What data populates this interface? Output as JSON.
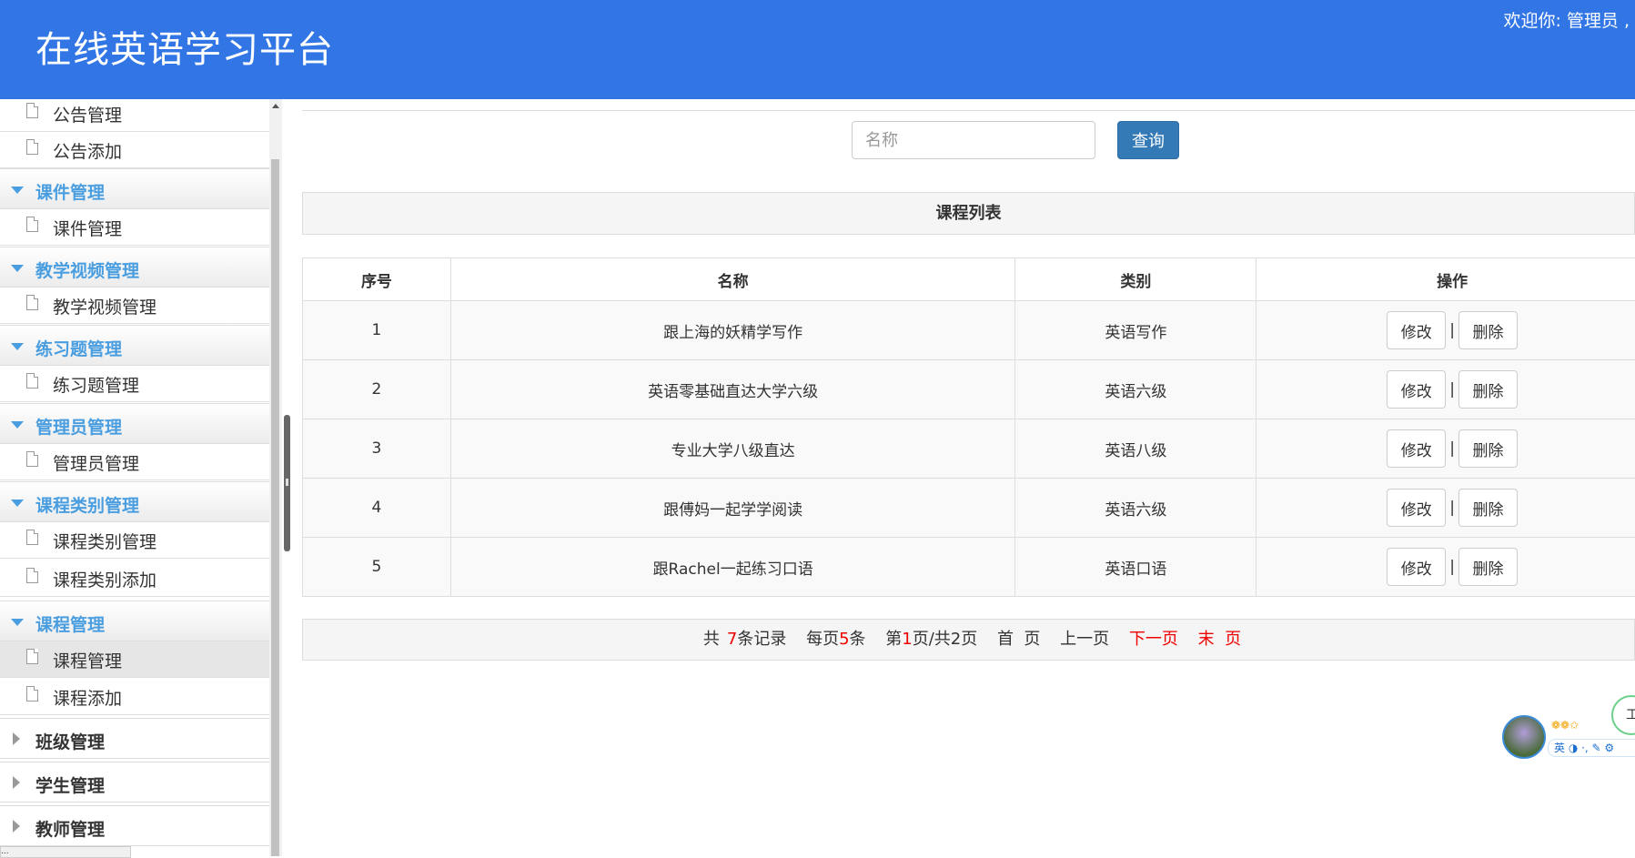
{
  "header": {
    "title": "在线英语学习平台",
    "welcome": "欢迎你: 管理员 ,"
  },
  "sidebar": {
    "top_items": [
      {
        "label": "公告管理"
      },
      {
        "label": "公告添加"
      }
    ],
    "groups": [
      {
        "label": "课件管理",
        "items": [
          {
            "label": "课件管理"
          }
        ]
      },
      {
        "label": "教学视频管理",
        "items": [
          {
            "label": "教学视频管理"
          }
        ]
      },
      {
        "label": "练习题管理",
        "items": [
          {
            "label": "练习题管理"
          }
        ]
      },
      {
        "label": "管理员管理",
        "items": [
          {
            "label": "管理员管理"
          }
        ]
      },
      {
        "label": "课程类别管理",
        "items": [
          {
            "label": "课程类别管理"
          },
          {
            "label": "课程类别添加"
          }
        ]
      },
      {
        "label": "课程管理",
        "items": [
          {
            "label": "课程管理"
          },
          {
            "label": "课程添加"
          }
        ]
      }
    ],
    "collapsed_groups": [
      {
        "label": "班级管理"
      },
      {
        "label": "学生管理"
      },
      {
        "label": "教师管理"
      }
    ],
    "active_item": "课程管理"
  },
  "status_bar": "...",
  "search": {
    "placeholder": "名称",
    "value": "",
    "button_label": "查询"
  },
  "list": {
    "title": "课程列表",
    "columns": [
      "序号",
      "名称",
      "类别",
      "操作"
    ],
    "rows": [
      {
        "index": "1",
        "name": "跟上海的妖精学写作",
        "category": "英语写作"
      },
      {
        "index": "2",
        "name": "英语零基础直达大学六级",
        "category": "英语六级"
      },
      {
        "index": "3",
        "name": "专业大学八级直达",
        "category": "英语八级"
      },
      {
        "index": "4",
        "name": "跟傅妈一起学学阅读",
        "category": "英语六级"
      },
      {
        "index": "5",
        "name": "跟Rachel一起练习口语",
        "category": "英语口语"
      }
    ],
    "edit_label": "修改",
    "delete_label": "删除",
    "separator": "|"
  },
  "pager": {
    "total_prefix": "共",
    "total": "7",
    "total_suffix": "条记录",
    "per_page_prefix": "每页",
    "per_page": "5",
    "per_page_suffix": "条",
    "page_prefix": "第",
    "current": "1",
    "page_mid": "页/共",
    "pages": "2",
    "page_suffix": "页",
    "first": "首  页",
    "prev": "上一页",
    "next": "下一页",
    "last": "末  页"
  },
  "widget": {
    "stars": "❁❁✩",
    "toolbar": "英 ◑ ·, ✎ ⚙",
    "bubble": "工"
  },
  "colors": {
    "header": "#3276e6",
    "accent": "#4a9ee0",
    "primary_button": "#337ab7",
    "highlight": "#e00000"
  }
}
